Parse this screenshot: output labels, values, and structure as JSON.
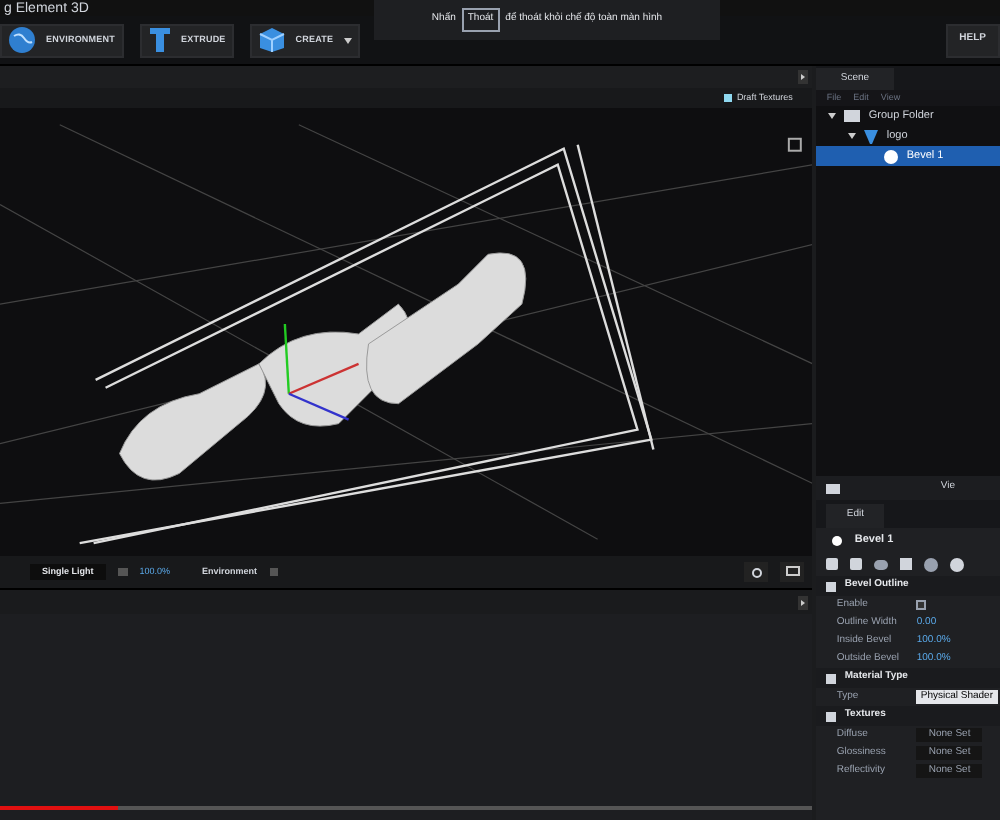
{
  "window": {
    "title": "g Element 3D"
  },
  "toolbar": {
    "buttons": [
      {
        "label": "ENVIRONMENT",
        "kind": "globe"
      },
      {
        "label": "EXTRUDE",
        "kind": "extrude"
      },
      {
        "label": "CREATE",
        "kind": "cube",
        "dropdown": true
      }
    ],
    "help": "HELP"
  },
  "fullscreen_notice": {
    "before": "Nhấn",
    "key": "Thoát",
    "after": "để thoát khỏi chế độ toàn màn hình"
  },
  "viewport": {
    "draft_textures": {
      "label": "Draft Textures",
      "checked": true
    },
    "bottom_bar": {
      "light": "Single Light",
      "light_level": "100.0%",
      "environment": {
        "label": "Environment",
        "checked": false
      }
    }
  },
  "scene_panel": {
    "tab": "Scene",
    "menu": [
      "File",
      "Edit",
      "View"
    ],
    "tree": [
      {
        "label": "Group Folder",
        "kind": "folder",
        "expanded": true,
        "selected": false,
        "children": [
          {
            "label": "logo",
            "kind": "extrude",
            "expanded": true,
            "selected": false,
            "children": [
              {
                "label": "Bevel 1",
                "kind": "sphere",
                "selected": true
              }
            ]
          }
        ]
      }
    ],
    "footer_label": "Vie"
  },
  "edit_panel": {
    "tab": "Edit",
    "object": "Bevel 1",
    "sections": [
      {
        "title": "Bevel Outline",
        "rows": [
          {
            "label": "Enable",
            "kind": "checkbox",
            "checked": false
          },
          {
            "label": "Outline Width",
            "kind": "number",
            "value": "0.00"
          },
          {
            "label": "Inside Bevel",
            "kind": "number",
            "value": "100.0%"
          },
          {
            "label": "Outside Bevel",
            "kind": "number",
            "value": "100.0%"
          }
        ]
      },
      {
        "title": "Material Type",
        "rows": [
          {
            "label": "Type",
            "kind": "select",
            "value": "Physical Shader"
          }
        ]
      },
      {
        "title": "Textures",
        "rows": [
          {
            "label": "Diffuse",
            "kind": "slot",
            "value": "None Set"
          },
          {
            "label": "Glossiness",
            "kind": "slot",
            "value": "None Set"
          },
          {
            "label": "Reflectivity",
            "kind": "slot",
            "value": "None Set"
          }
        ]
      }
    ]
  },
  "video_progress": {
    "level": 0.146
  }
}
